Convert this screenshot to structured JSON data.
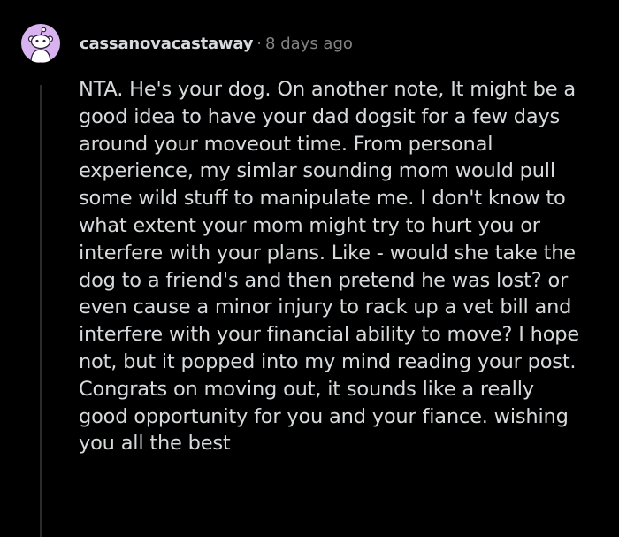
{
  "comment": {
    "author": "cassanovacastaway",
    "separator": "·",
    "timestamp": "8 days ago",
    "avatar_icon": "reddit-snoo-icon",
    "avatar_color": "#d9b3f0",
    "body_lines": [
      "NTA. He's your dog. On another note, It might be a",
      "good idea to have your dad dogsit for a few days",
      "around your moveout time. From personal",
      "experience, my simlar sounding mom would pull",
      "some wild stuff to manipulate me. I don't know to",
      "what extent your mom might try to hurt you or",
      "interfere with your plans. Like - would she take the",
      "dog to a friend's and then pretend he was lost? or",
      "even cause a minor injury to rack up a vet bill and",
      "interfere with your financial ability to move? I hope",
      "not, but it popped into my mind reading your post.",
      "Congrats on moving out, it sounds like a really",
      "good opportunity for you and your fiance. wishing",
      "you all the best"
    ]
  },
  "colors": {
    "background": "#000000",
    "text": "#d7dadc",
    "meta": "#818384",
    "thread_line": "#2a2b2d"
  }
}
